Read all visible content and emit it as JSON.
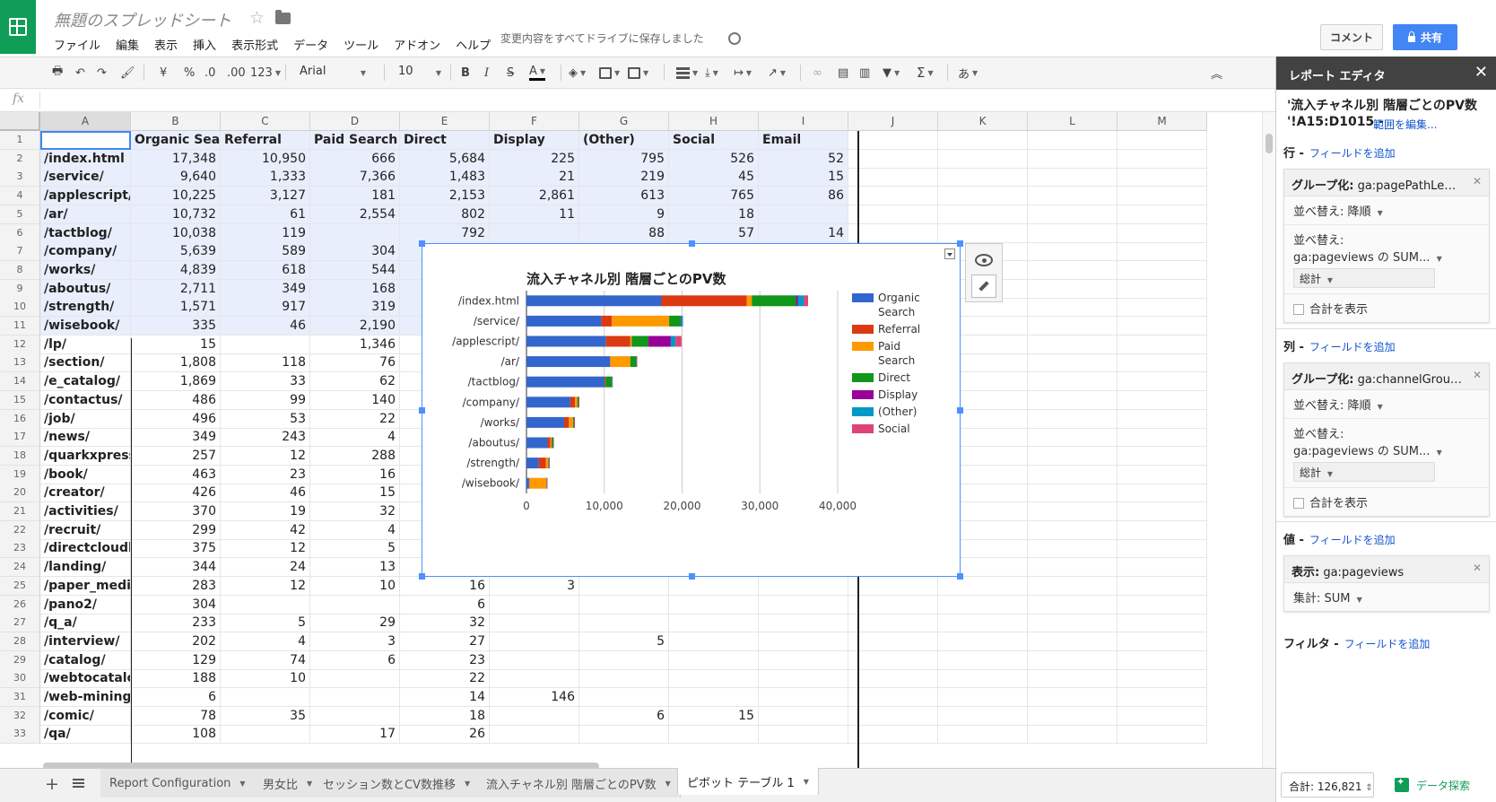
{
  "app": {
    "title": "無題のスプレッドシート",
    "save_status": "変更内容をすべてドライブに保存しました",
    "comment_label": "コメント",
    "share_label": "共有"
  },
  "menu": [
    "ファイル",
    "編集",
    "表示",
    "挿入",
    "表示形式",
    "データ",
    "ツール",
    "アドオン",
    "ヘルプ"
  ],
  "toolbar": {
    "currency": "¥",
    "percent": "%",
    "dec_decrease": ".0",
    "dec_increase": ".00",
    "more_formats": "123",
    "font": "Arial",
    "font_size": "10",
    "bold": "B",
    "italic": "I",
    "strike": "S",
    "text_color": "A",
    "input_tools": "あ",
    "functions": "Σ",
    "icons": [
      "print-icon",
      "undo-icon",
      "redo-icon",
      "paint-format-icon",
      "fill-color-icon",
      "borders-icon",
      "merge-icon",
      "align-icon",
      "valign-icon",
      "wrap-icon",
      "rotate-icon",
      "link-icon",
      "comment-icon",
      "chart-icon",
      "filter-icon",
      "collapse-icon"
    ]
  },
  "formula_bar": {
    "fx": "fx",
    "value": ""
  },
  "grid": {
    "columns": [
      "A",
      "B",
      "C",
      "D",
      "E",
      "F",
      "G",
      "H",
      "I",
      "J",
      "K",
      "L",
      "M"
    ],
    "header_row": [
      "",
      "Organic Search",
      "Referral",
      "Paid Search",
      "Direct",
      "Display",
      "(Other)",
      "Social",
      "Email"
    ],
    "rows": [
      [
        "/index.html",
        "17,348",
        "10,950",
        "666",
        "5,684",
        "225",
        "795",
        "526",
        "52"
      ],
      [
        "/service/",
        "9,640",
        "1,333",
        "7,366",
        "1,483",
        "21",
        "219",
        "45",
        "15"
      ],
      [
        "/applescript/",
        "10,225",
        "3,127",
        "181",
        "2,153",
        "2,861",
        "613",
        "765",
        "86"
      ],
      [
        "/ar/",
        "10,732",
        "61",
        "2,554",
        "802",
        "11",
        "9",
        "18",
        ""
      ],
      [
        "/tactblog/",
        "10,038",
        "119",
        "",
        "792",
        "",
        "88",
        "57",
        "14"
      ],
      [
        "/company/",
        "5,639",
        "589",
        "304",
        "",
        "",
        "",
        "",
        ""
      ],
      [
        "/works/",
        "4,839",
        "618",
        "544",
        "",
        "",
        "",
        "",
        ""
      ],
      [
        "/aboutus/",
        "2,711",
        "349",
        "168",
        "",
        "",
        "",
        "",
        ""
      ],
      [
        "/strength/",
        "1,571",
        "917",
        "319",
        "",
        "",
        "",
        "",
        ""
      ],
      [
        "/wisebook/",
        "335",
        "46",
        "2,190",
        "",
        "",
        "",
        "",
        ""
      ],
      [
        "/lp/",
        "15",
        "",
        "1,346",
        "",
        "",
        "",
        "",
        ""
      ],
      [
        "/section/",
        "1,808",
        "118",
        "76",
        "",
        "",
        "",
        "",
        ""
      ],
      [
        "/e_catalog/",
        "1,869",
        "33",
        "62",
        "",
        "",
        "",
        "",
        ""
      ],
      [
        "/contactus/",
        "486",
        "99",
        "140",
        "",
        "",
        "",
        "",
        ""
      ],
      [
        "/job/",
        "496",
        "53",
        "22",
        "",
        "",
        "",
        "",
        ""
      ],
      [
        "/news/",
        "349",
        "243",
        "4",
        "",
        "",
        "",
        "",
        ""
      ],
      [
        "/quarkxpress",
        "257",
        "12",
        "288",
        "",
        "",
        "",
        "",
        ""
      ],
      [
        "/book/",
        "463",
        "23",
        "16",
        "",
        "",
        "",
        "",
        ""
      ],
      [
        "/creator/",
        "426",
        "46",
        "15",
        "",
        "",
        "",
        "",
        ""
      ],
      [
        "/activities/",
        "370",
        "19",
        "32",
        "",
        "",
        "",
        "",
        ""
      ],
      [
        "/recruit/",
        "299",
        "42",
        "4",
        "",
        "",
        "",
        "",
        ""
      ],
      [
        "/directcloudb",
        "375",
        "12",
        "5",
        "",
        "",
        "",
        "",
        ""
      ],
      [
        "/landing/",
        "344",
        "24",
        "13",
        "",
        "",
        "",
        "",
        ""
      ],
      [
        "/paper_mediu",
        "283",
        "12",
        "10",
        "16",
        "3",
        "",
        "",
        ""
      ],
      [
        "/pano2/",
        "304",
        "",
        "",
        "6",
        "",
        "",
        "",
        ""
      ],
      [
        "/q_a/",
        "233",
        "5",
        "29",
        "32",
        "",
        "",
        "",
        ""
      ],
      [
        "/interview/",
        "202",
        "4",
        "3",
        "27",
        "",
        "5",
        "",
        ""
      ],
      [
        "/catalog/",
        "129",
        "74",
        "6",
        "23",
        "",
        "",
        "",
        ""
      ],
      [
        "/webtocatalog",
        "188",
        "10",
        "",
        "22",
        "",
        "",
        "",
        ""
      ],
      [
        "/web-mining/",
        "6",
        "",
        "",
        "14",
        "146",
        "",
        "",
        ""
      ],
      [
        "/comic/",
        "78",
        "35",
        "",
        "18",
        "",
        "6",
        "15",
        ""
      ],
      [
        "/qa/",
        "108",
        "",
        "17",
        "26",
        "",
        "",
        "",
        ""
      ]
    ]
  },
  "sheet_tabs": [
    "Report Configuration",
    "男女比",
    "セッション数とCV数推移",
    "流入チャネル別 階層ごとのPV数",
    "ピボット テーブル 1"
  ],
  "status": {
    "total": "合計: 126,821",
    "explore_label": "データ探索"
  },
  "panel": {
    "title": "レポート エディタ",
    "range_title": "'流入チャネル別 階層ごとのPV数",
    "range_ref": "'!A15:D1015 -",
    "edit_range": "範囲を編集...",
    "add_field": "フィールドを追加",
    "rows_label": "行 -",
    "cols_label": "列 -",
    "values_label": "値 -",
    "filter_label": "フィルタ -",
    "row_group": {
      "prefix": "グループ化:",
      "field": "ga:pagePathLe…",
      "sort": "並べ替え: 降順",
      "sort_by_label": "並べ替え:",
      "sort_by": "ga:pageviews の SUM...",
      "total": "総計",
      "show_total": "合計を表示"
    },
    "col_group": {
      "prefix": "グループ化:",
      "field": "ga:channelGrou…",
      "sort": "並べ替え: 降順",
      "sort_by_label": "並べ替え:",
      "sort_by": "ga:pageviews の SUM...",
      "total": "総計",
      "show_total": "合計を表示"
    },
    "value": {
      "prefix": "表示:",
      "field": "ga:pageviews",
      "agg": "集計: SUM"
    }
  },
  "chart_data": {
    "type": "bar",
    "orientation": "horizontal",
    "stacked": true,
    "title": "流入チャネル別 階層ごとのPV数",
    "categories": [
      "/index.html",
      "/service/",
      "/applescript/",
      "/ar/",
      "/tactblog/",
      "/company/",
      "/works/",
      "/aboutus/",
      "/strength/",
      "/wisebook/"
    ],
    "xlim": [
      0,
      40000
    ],
    "xticks": [
      "0",
      "10,000",
      "20,000",
      "30,000",
      "40,000"
    ],
    "legend_position": "right",
    "grid": true,
    "series": [
      {
        "name": "Organic Search",
        "color": "#3366cc",
        "values": [
          17348,
          9640,
          10225,
          10732,
          10038,
          5639,
          4839,
          2711,
          1571,
          335
        ]
      },
      {
        "name": "Referral",
        "color": "#dc3912",
        "values": [
          10950,
          1333,
          3127,
          61,
          119,
          589,
          618,
          349,
          917,
          46
        ]
      },
      {
        "name": "Paid Search",
        "color": "#ff9900",
        "values": [
          666,
          7366,
          181,
          2554,
          0,
          304,
          544,
          168,
          319,
          2190
        ]
      },
      {
        "name": "Direct",
        "color": "#109618",
        "values": [
          5684,
          1483,
          2153,
          802,
          792,
          186,
          120,
          210,
          90,
          50
        ]
      },
      {
        "name": "Display",
        "color": "#990099",
        "values": [
          225,
          21,
          2861,
          11,
          0,
          10,
          30,
          20,
          20,
          20
        ]
      },
      {
        "name": "(Other)",
        "color": "#0099c6",
        "values": [
          795,
          219,
          613,
          9,
          88,
          20,
          20,
          10,
          10,
          10
        ]
      },
      {
        "name": "Social",
        "color": "#dd4477",
        "values": [
          526,
          45,
          765,
          18,
          57,
          10,
          10,
          10,
          10,
          10
        ]
      }
    ]
  }
}
